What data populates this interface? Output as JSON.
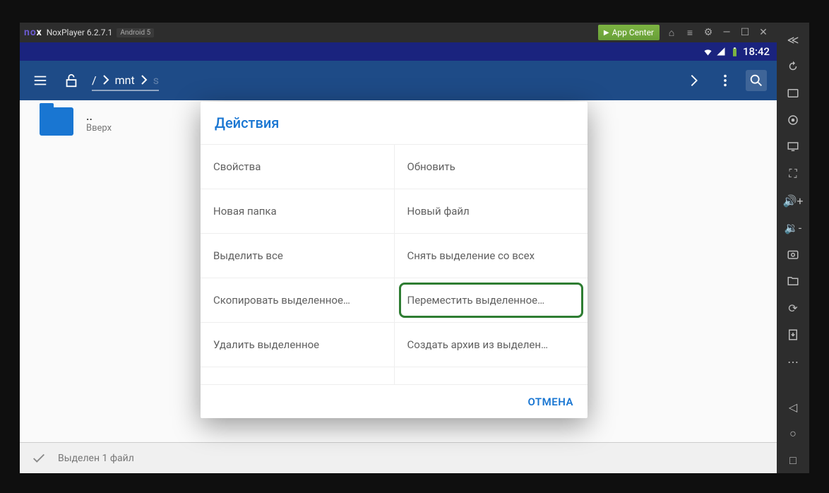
{
  "nox": {
    "logo_prefix": "no",
    "logo_suffix": "x",
    "title": "NoxPlayer 6.2.7.1",
    "badge": "Android 5",
    "app_center": "App Center"
  },
  "statusbar": {
    "time": "18:42"
  },
  "breadcrumb": {
    "root": "/",
    "seg1": "mnt",
    "seg2": "s"
  },
  "files": {
    "up": {
      "name": "..",
      "sub": "Вверх"
    }
  },
  "selection": {
    "text": "Выделен 1 файл"
  },
  "dialog": {
    "title": "Действия",
    "cancel": "ОТМЕНА",
    "items": {
      "properties": "Свойства",
      "refresh": "Обновить",
      "new_folder": "Новая папка",
      "new_file": "Новый файл",
      "select_all": "Выделить все",
      "deselect_all": "Снять выделение со всех",
      "copy_sel": "Скопировать выделенное…",
      "move_sel": "Переместить выделенное…",
      "delete_sel": "Удалить выделенное",
      "archive_sel": "Создать архив из выделен…"
    }
  }
}
